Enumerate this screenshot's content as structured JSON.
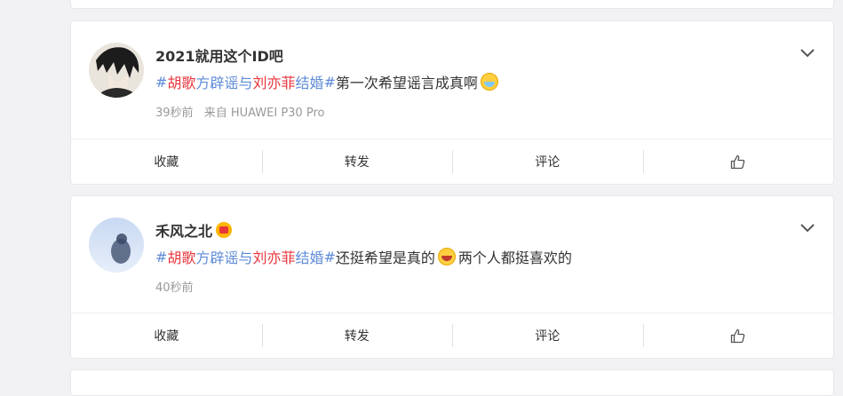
{
  "actions": {
    "collect": "收藏",
    "repost": "转发",
    "comment": "评论",
    "like_icon": "thumbs-up-icon"
  },
  "posts": [
    {
      "username": "2021就用这个ID吧",
      "topic_hash_open": "#",
      "topic_part1": "胡歌",
      "topic_part2": "方辟谣与",
      "topic_part3": "刘亦菲",
      "topic_part4": "结婚",
      "topic_hash_close": "#",
      "text_before_emoji": "第一次希望谣言成真啊",
      "emoji": "crying-face-emoji",
      "text_after_emoji": "",
      "time": "39秒前",
      "source": "来自 HUAWEI P30 Pro"
    },
    {
      "username": "禾风之北",
      "badge": "crown-badge-icon",
      "topic_hash_open": "#",
      "topic_part1": "胡歌",
      "topic_part2": "方辟谣与",
      "topic_part3": "刘亦菲",
      "topic_part4": "结婚",
      "topic_hash_close": "#",
      "text_before_emoji": "还挺希望是真的",
      "emoji": "laughing-face-emoji",
      "text_after_emoji": "两个人都挺喜欢的",
      "time": "40秒前",
      "source": ""
    }
  ]
}
